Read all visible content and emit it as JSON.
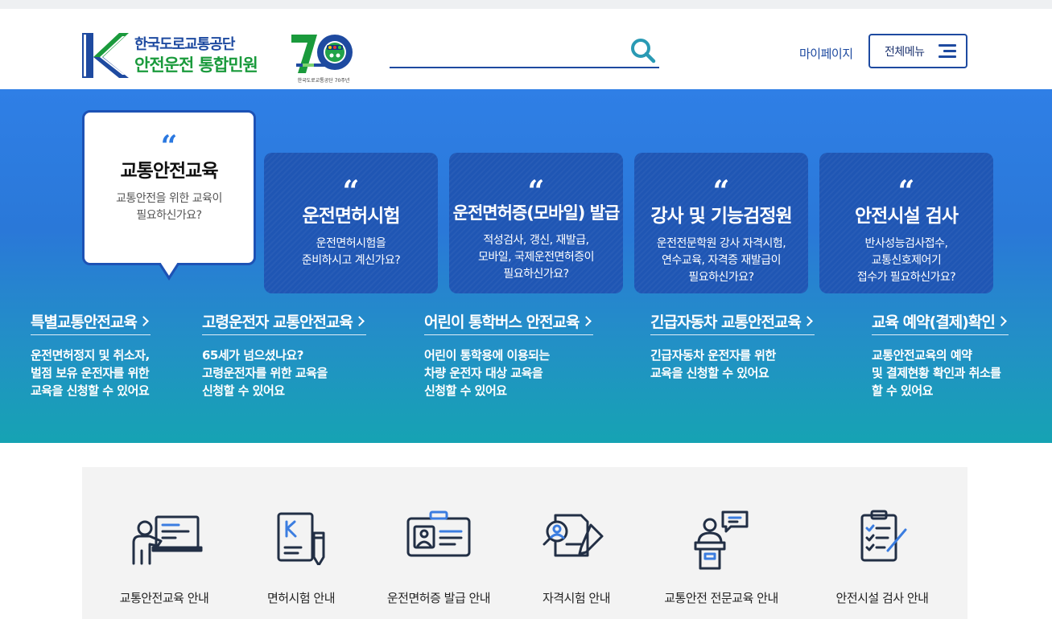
{
  "header": {
    "org_name": "한국도로교통공단",
    "site_name": "안전운전 통합민원",
    "anniversary_caption": "한국도로교통공단 70주년",
    "search_placeholder": "",
    "mypage_label": "마이페이지",
    "allmenu_label": "전체메뉴"
  },
  "hero": {
    "cards": [
      {
        "title": "교통안전교육",
        "desc": "교통안전을 위한 교육이\n필요하신가요?",
        "active": true
      },
      {
        "title": "운전면허시험",
        "desc": "운전면허시험을\n준비하시고 계신가요?"
      },
      {
        "title": "운전면허증(모바일) 발급",
        "desc": "적성검사, 갱신, 재발급,\n모바일, 국제운전면허증이\n필요하신가요?"
      },
      {
        "title": "강사 및 기능검정원",
        "desc": "운전전문학원 강사 자격시험,\n연수교육, 자격증 재발급이\n필요하신가요?"
      },
      {
        "title": "안전시설 검사",
        "desc": "반사성능검사접수,\n교통신호제어기\n접수가 필요하신가요?"
      }
    ],
    "quote_mark": "“",
    "sub_links": [
      {
        "title": "특별교통안전교육",
        "desc": "운전면허정지 및 취소자,\n벌점 보유 운전자를 위한\n교육을 신청할 수 있어요"
      },
      {
        "title": "고령운전자 교통안전교육",
        "desc": "65세가 넘으셨나요?\n고령운전자를 위한 교육을\n신청할 수 있어요"
      },
      {
        "title": "어린이 통학버스 안전교육",
        "desc": "어린이 통학용에 이용되는\n차량 운전자 대상 교육을\n신청할 수 있어요"
      },
      {
        "title": "긴급자동차 교통안전교육",
        "desc": "긴급자동차 운전자를 위한\n교육을 신청할 수 있어요"
      },
      {
        "title": "교육 예약(결제)확인",
        "desc": "교통안전교육의 예약\n및 결제현황 확인과 취소를\n할 수 있어요"
      }
    ]
  },
  "guide": {
    "items": [
      {
        "label": "교통안전교육 안내",
        "icon": "teacher-board-icon"
      },
      {
        "label": "면허시험 안내",
        "icon": "document-pen-icon"
      },
      {
        "label": "운전면허증 발급 안내",
        "icon": "id-card-icon"
      },
      {
        "label": "자격시험 안내",
        "icon": "exam-search-icon"
      },
      {
        "label": "교통안전 전문교육 안내",
        "icon": "lecturer-podium-icon"
      },
      {
        "label": "안전시설 검사 안내",
        "icon": "checklist-icon"
      }
    ]
  },
  "colors": {
    "brand_blue": "#1e4aa0",
    "brand_green": "#1a9a3c",
    "hero_top": "#2f7fe6",
    "hero_bottom": "#16a3b3",
    "card_blue": "#1f56b4",
    "guide_bg": "#f3f3f3"
  }
}
